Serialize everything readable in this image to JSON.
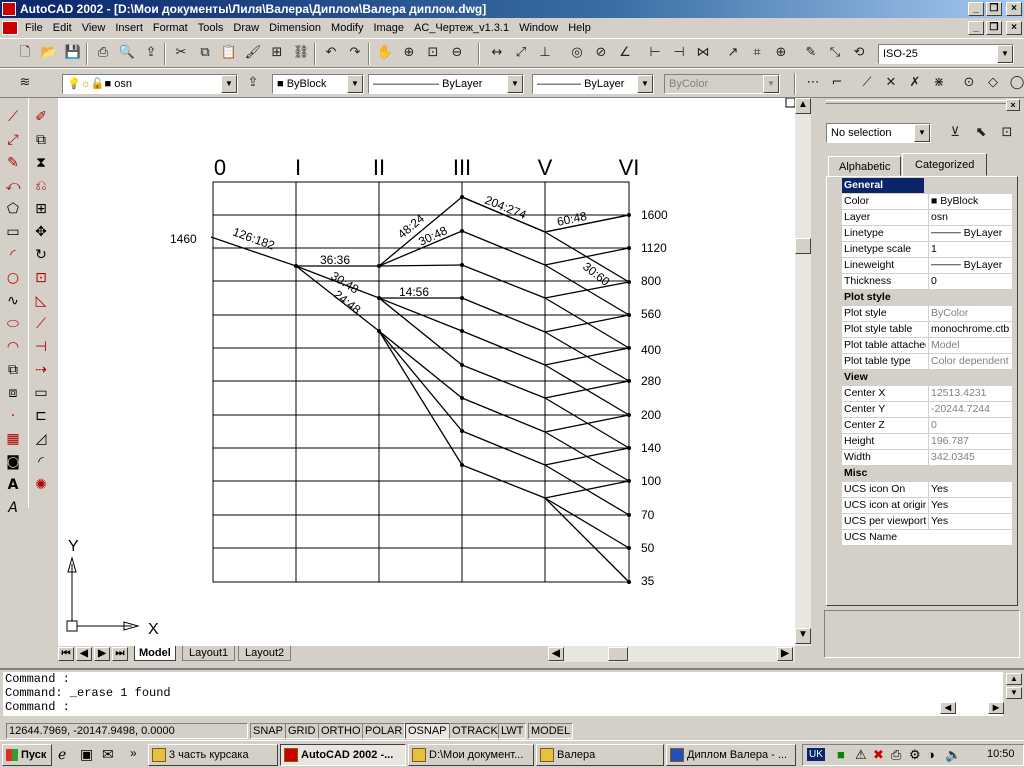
{
  "window": {
    "title": "AutoCAD 2002 - [D:\\Мои документы\\Лиля\\Валера\\Диплом\\Валера диплом.dwg]"
  },
  "menu": [
    "File",
    "Edit",
    "View",
    "Insert",
    "Format",
    "Tools",
    "Draw",
    "Dimension",
    "Modify",
    "Image",
    "AC_Чертеж_v1.3.1",
    "Window",
    "Help"
  ],
  "toolbar": {
    "dimstyle": "ISO-25",
    "layer": "osn",
    "color": "ByBlock",
    "linetype": "ByLayer",
    "lineweight": "ByLayer",
    "plotstyle": "ByColor"
  },
  "drawing": {
    "column_labels": [
      "0",
      "I",
      "II",
      "III",
      "V",
      "VI"
    ],
    "right_labels": [
      "1600",
      "1120",
      "800",
      "560",
      "400",
      "280",
      "200",
      "140",
      "100",
      "70",
      "50",
      "35"
    ],
    "left_label": "1460",
    "annotations": [
      "126:182",
      "36:36",
      "30:48",
      "24:48",
      "48:24",
      "30:48",
      "14:56",
      "204:274",
      "60:48",
      "30:60"
    ],
    "ucs": {
      "x": "X",
      "y": "Y"
    }
  },
  "tabs": [
    "Model",
    "Layout1",
    "Layout2"
  ],
  "properties": {
    "selection": "No selection",
    "tab_alphabetic": "Alphabetic",
    "tab_categorized": "Categorized",
    "rows": [
      {
        "k": "General",
        "cat": true
      },
      {
        "k": "Color",
        "v": "ByBlock"
      },
      {
        "k": "Layer",
        "v": "osn"
      },
      {
        "k": "Linetype",
        "v": "ByLayer"
      },
      {
        "k": "Linetype scale",
        "v": "1"
      },
      {
        "k": "Lineweight",
        "v": "ByLayer"
      },
      {
        "k": "Thickness",
        "v": "0"
      },
      {
        "k": "Plot style",
        "cat": true
      },
      {
        "k": "Plot style",
        "v": "ByColor",
        "grey": true
      },
      {
        "k": "Plot style table",
        "v": "monochrome.ctb"
      },
      {
        "k": "Plot table attached",
        "v": "Model",
        "grey": true
      },
      {
        "k": "Plot table type",
        "v": "Color dependent",
        "grey": true
      },
      {
        "k": "View",
        "cat": true
      },
      {
        "k": "Center X",
        "v": "12513.4231",
        "grey": true
      },
      {
        "k": "Center Y",
        "v": "-20244.7244",
        "grey": true
      },
      {
        "k": "Center Z",
        "v": "0",
        "grey": true
      },
      {
        "k": "Height",
        "v": "196.787",
        "grey": true
      },
      {
        "k": "Width",
        "v": "342.0345",
        "grey": true
      },
      {
        "k": "Misc",
        "cat": true
      },
      {
        "k": "UCS icon On",
        "v": "Yes"
      },
      {
        "k": "UCS icon at origin",
        "v": "Yes"
      },
      {
        "k": "UCS per viewport",
        "v": "Yes"
      },
      {
        "k": "UCS Name",
        "v": ""
      }
    ]
  },
  "command": {
    "lines": [
      "Command :",
      "Command: _erase 1 found",
      "Command :"
    ]
  },
  "status": {
    "coords": "12644.7969, -20147.9498, 0.0000",
    "buttons": [
      "SNAP",
      "GRID",
      "ORTHO",
      "POLAR",
      "OSNAP",
      "OTRACK",
      "LWT",
      "MODEL"
    ]
  },
  "taskbar": {
    "start": "Пуск",
    "tasks": [
      "3 часть курсака",
      "AutoCAD 2002 -...",
      "D:\\Мои документ...",
      "Валера",
      "Диплом Валера - ..."
    ],
    "lang": "UK",
    "clock": "10:50"
  }
}
